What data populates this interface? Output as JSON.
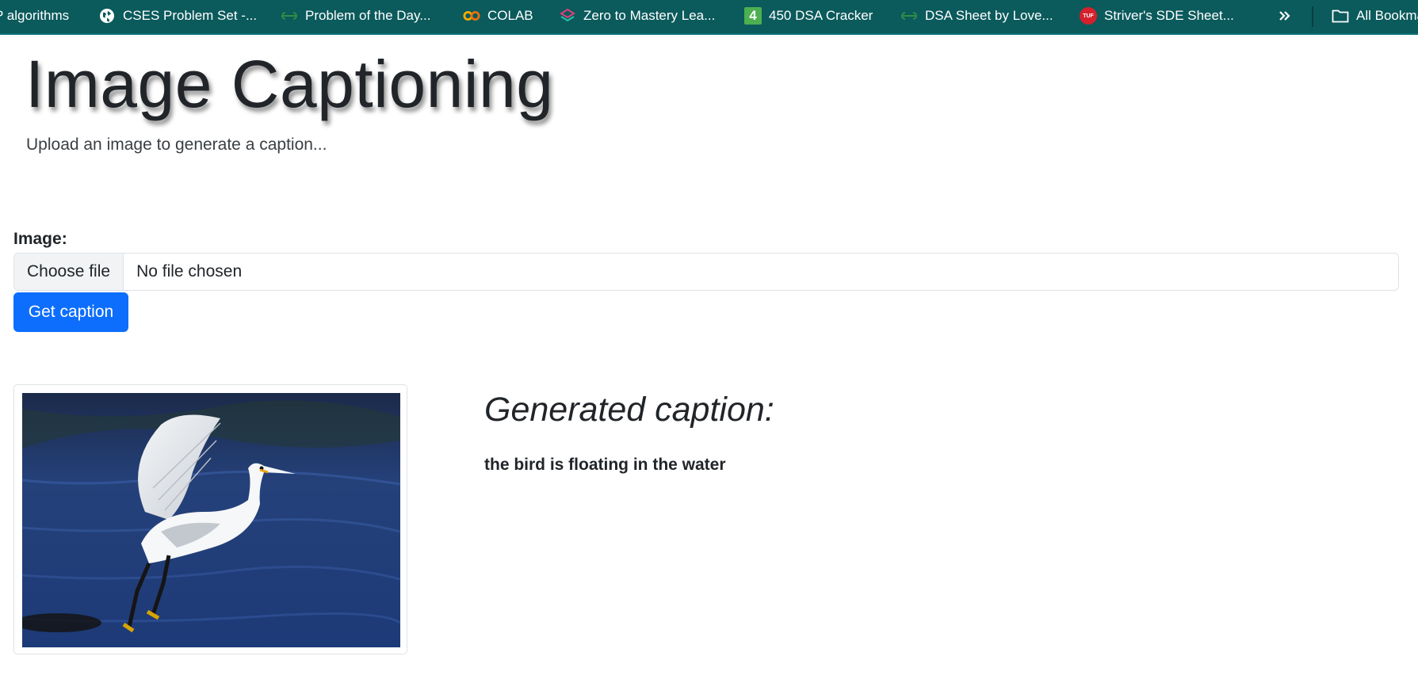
{
  "bookmarks": {
    "items": [
      {
        "label": "P algorithms",
        "icon": "none"
      },
      {
        "label": "CSES Problem Set -...",
        "icon": "globe-icon"
      },
      {
        "label": "Problem of the Day...",
        "icon": "gfg-icon"
      },
      {
        "label": "COLAB",
        "icon": "colab-icon"
      },
      {
        "label": "Zero to Mastery Lea...",
        "icon": "ztm-icon"
      },
      {
        "label": "450 DSA Cracker",
        "icon": "number-4-icon"
      },
      {
        "label": "DSA Sheet by Love...",
        "icon": "gfg-icon"
      },
      {
        "label": "Striver's SDE Sheet...",
        "icon": "tuf-icon"
      }
    ],
    "overflow_icon": "double-chevron-right-icon",
    "all_bookmarks": {
      "label": "All Bookmarks",
      "icon": "folder-icon"
    },
    "colors": {
      "bar": "#0b5a5c",
      "text": "#ffffff"
    }
  },
  "page": {
    "title": "Image Captioning",
    "subtitle": "Upload an image to generate a caption..."
  },
  "form": {
    "image_label": "Image:",
    "choose_file_label": "Choose file",
    "file_status": "No file chosen",
    "submit_label": "Get caption",
    "submit_color": "#0d6efd"
  },
  "result": {
    "heading": "Generated caption:",
    "caption": "the bird is floating in the water"
  }
}
